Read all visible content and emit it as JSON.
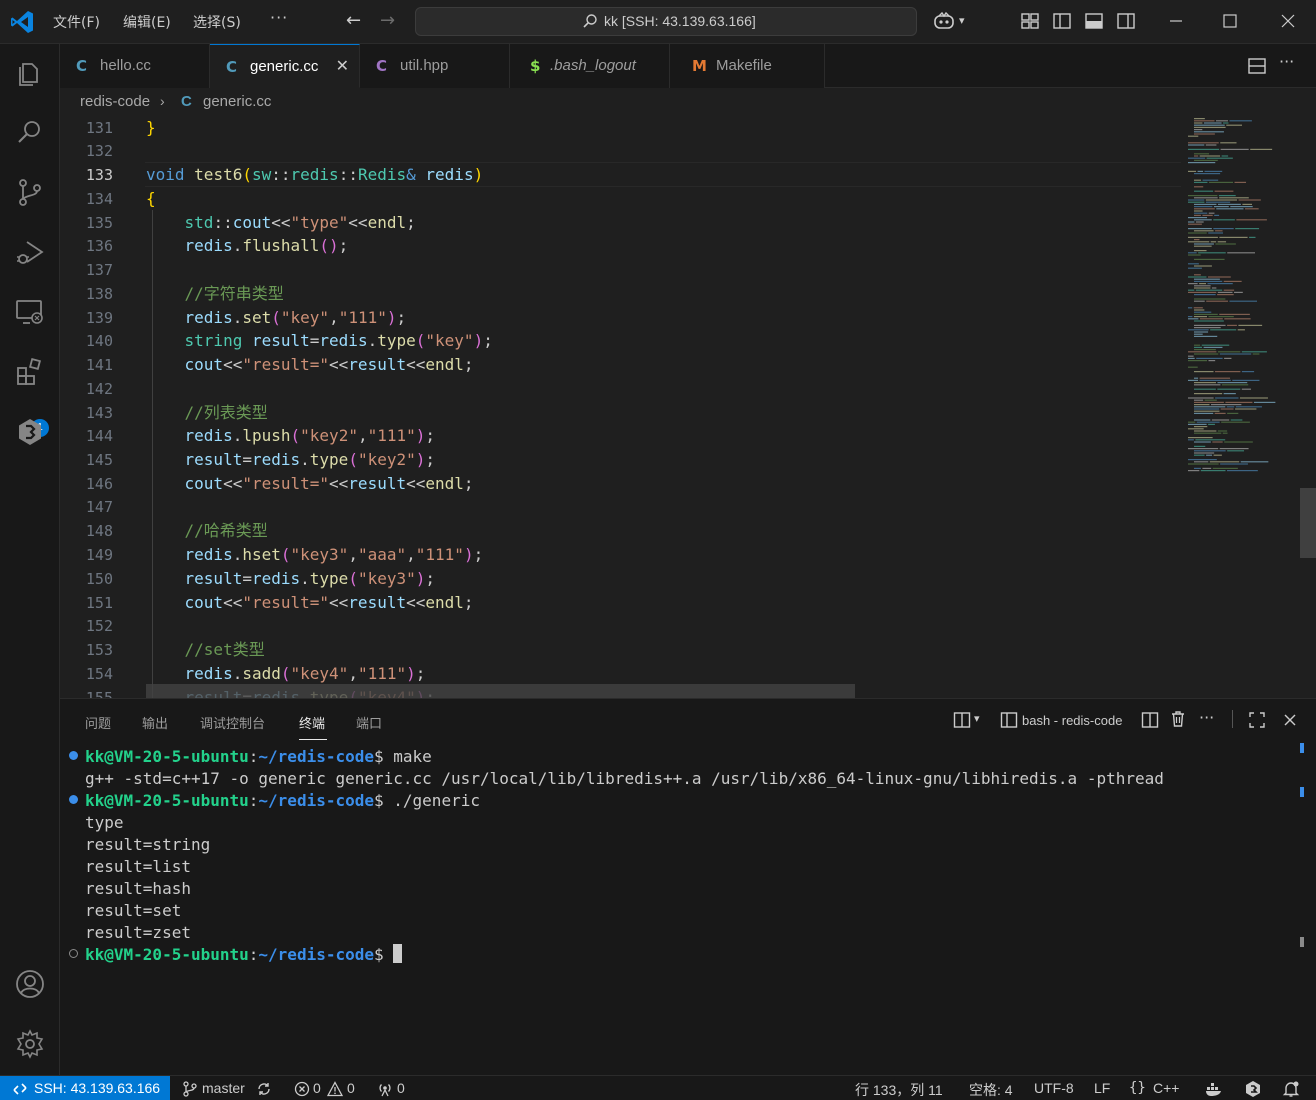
{
  "titlebar": {
    "menus": [
      "文件(F)",
      "编辑(E)",
      "选择(S)"
    ],
    "more": "···",
    "search_text": "kk [SSH: 43.139.63.166]"
  },
  "activitybar": {
    "items": [
      "explorer-icon",
      "search-icon",
      "source-control-icon",
      "run-debug-icon",
      "remote-explorer-icon",
      "extensions-icon",
      "docker-icon"
    ],
    "extensions_badge": "1",
    "bottom": [
      "account-icon",
      "manage-gear-icon"
    ]
  },
  "tabs": [
    {
      "label": "hello.cc",
      "icon": "C",
      "color": "#519aba",
      "active": false
    },
    {
      "label": "generic.cc",
      "icon": "C",
      "color": "#519aba",
      "active": true
    },
    {
      "label": "util.hpp",
      "icon": "C",
      "color": "#a074c4",
      "active": false
    },
    {
      "label": ".bash_logout",
      "icon": "$",
      "color": "#89e051",
      "active": false
    },
    {
      "label": "Makefile",
      "icon": "M",
      "color": "#e37933",
      "active": false
    }
  ],
  "breadcrumb": {
    "folder": "redis-code",
    "file": "generic.cc"
  },
  "editor": {
    "line_numbers": [
      "131",
      "132",
      "133",
      "134",
      "135",
      "136",
      "137",
      "138",
      "139",
      "140",
      "141",
      "142",
      "143",
      "144",
      "145",
      "146",
      "147",
      "148",
      "149",
      "150",
      "151",
      "152",
      "153",
      "154",
      "155"
    ],
    "current_line": "133"
  },
  "panel": {
    "tabs": [
      "问题",
      "输出",
      "调试控制台",
      "终端",
      "端口"
    ],
    "active_tab": "终端",
    "terminal_name": "bash - redis-code",
    "terminal": {
      "prompt_user": "kk@VM-20-5-ubuntu",
      "prompt_sep": ":",
      "prompt_path": "~/redis-code",
      "prompt_dollar": "$",
      "cmd1": " make",
      "out1": "g++ -std=c++17 -o generic generic.cc /usr/local/lib/libredis++.a /usr/lib/x86_64-linux-gnu/libhiredis.a -pthread",
      "cmd2": " ./generic",
      "outputs": [
        "type",
        "result=string",
        "result=list",
        "result=hash",
        "result=set",
        "result=zset"
      ]
    }
  },
  "statusbar": {
    "remote": "SSH: 43.139.63.166",
    "branch": "master",
    "errors": "0",
    "warnings": "0",
    "ports": "0",
    "position": "行 133，列 11",
    "spaces": "空格: 4",
    "encoding": "UTF-8",
    "eol": "LF",
    "language": "C++"
  },
  "colors": {
    "accent": "#0078d4",
    "bg": "#1f1f1f",
    "prompt_green": "#23d18b",
    "prompt_blue": "#3b8eea"
  }
}
